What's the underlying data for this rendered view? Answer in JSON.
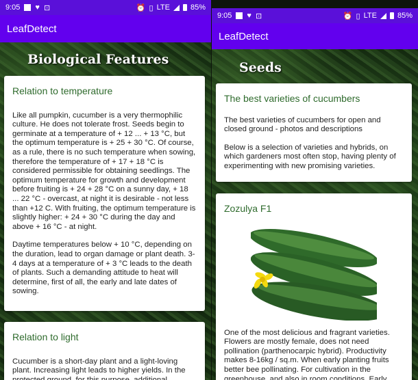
{
  "left_screen": {
    "status": {
      "time": "9:05",
      "network": "LTE",
      "battery": "85%"
    },
    "app_title": "LeafDetect",
    "section_title": "Biological Features",
    "cards": [
      {
        "heading": "Relation to temperature",
        "paragraphs": [
          "Like all pumpkin, cucumber is a very thermophilic culture. He does not tolerate frost. Seeds begin to germinate at a temperature of + 12 ... + 13 °C, but the optimum temperature is + 25 + 30 °C. Of course, as a rule, there is no such temperature when sowing, therefore the temperature of + 17 + 18 °C is considered permissible for obtaining seedlings. The optimum temperature for growth and development before fruiting is + 24 + 28 °C on a sunny day, + 18 ... 22 °C - overcast, at night it is desirable - not less than +12 C. With fruiting, the optimum temperature is slightly higher: + 24 + 30 °C during the day and above + 16 °C - at night.",
          "Daytime temperatures below + 10 °C, depending on the duration, lead to organ damage or plant death. 3-4 days at a temperature of + 3 °C leads to the death of plants. Such a demanding attitude to heat will determine, first of all, the early and late dates of sowing."
        ]
      },
      {
        "heading": "Relation to light",
        "paragraphs": [
          "Cucumber is a short-day plant and a light-loving plant. Increasing light leads to higher yields. In the protected ground, for this purpose, additional"
        ]
      }
    ]
  },
  "right_screen": {
    "status": {
      "time": "9:05",
      "network": "LTE",
      "battery": "85%"
    },
    "app_title": "LeafDetect",
    "section_title": "Seeds",
    "cards": [
      {
        "heading": "The best varieties of cucumbers",
        "paragraphs": [
          "The best varieties of cucumbers for open and closed ground - photos and descriptions",
          "Below is a selection of varieties and hybrids, on which gardeners most often stop, having plenty of experimenting with new promising varieties."
        ]
      },
      {
        "heading": "Zozulya F1",
        "image": "cucumbers-photo",
        "paragraphs": [
          "One of the most delicious and fragrant varieties. Flowers are mostly female, does not need pollination (parthenocarpic hybrid). Productivity makes 8-16kg / sq.m. When early planting fruits better bee pollinating. For cultivation in the greenhouse, and also in room conditions. Early"
        ]
      }
    ]
  }
}
